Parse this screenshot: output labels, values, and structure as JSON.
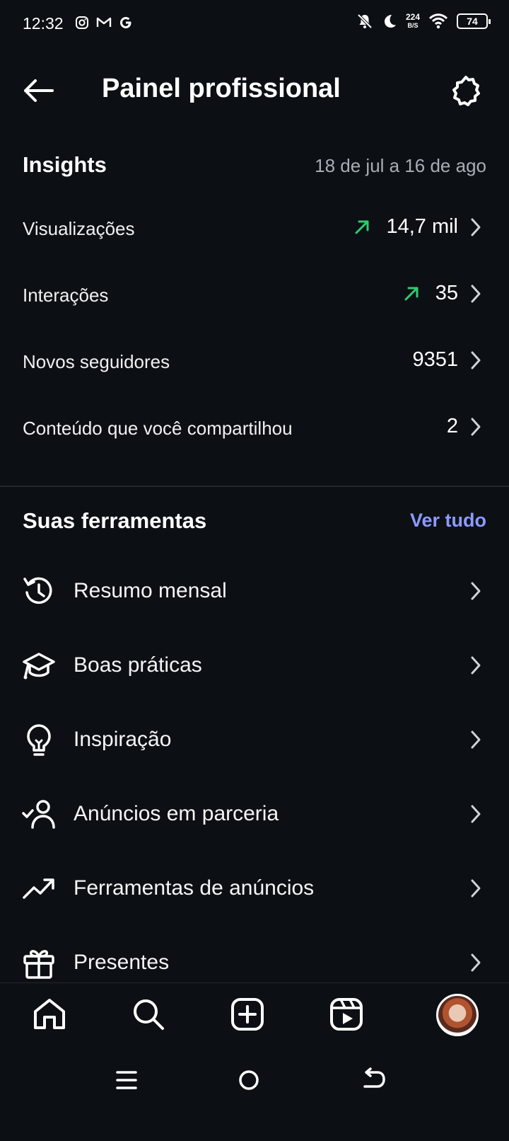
{
  "status_bar": {
    "time": "12:32",
    "net_speed_value": "224",
    "net_speed_unit": "B/S",
    "battery": "74",
    "app_icons": [
      "instagram-icon",
      "gmail-icon",
      "google-icon"
    ],
    "system_icons": [
      "bell-off-icon",
      "moon-icon",
      "wifi-icon",
      "battery-icon"
    ]
  },
  "header": {
    "title": "Painel profissional"
  },
  "insights": {
    "title": "Insights",
    "date_range": "18 de jul a 16 de ago",
    "metrics": [
      {
        "label": "Visualizações",
        "value": "14,7 mil",
        "trend": "up"
      },
      {
        "label": "Interações",
        "value": "35",
        "trend": "up"
      },
      {
        "label": "Novos seguidores",
        "value": "9351",
        "trend": "none"
      },
      {
        "label": "Conteúdo que você compartilhou",
        "value": "2",
        "trend": "none"
      }
    ]
  },
  "tools": {
    "title": "Suas ferramentas",
    "see_all": "Ver tudo",
    "items": [
      {
        "label": "Resumo mensal",
        "icon": "history-icon"
      },
      {
        "label": "Boas práticas",
        "icon": "graduation-cap-icon"
      },
      {
        "label": "Inspiração",
        "icon": "lightbulb-icon"
      },
      {
        "label": "Anúncios em parceria",
        "icon": "person-check-icon"
      },
      {
        "label": "Ferramentas de anúncios",
        "icon": "trending-up-icon"
      },
      {
        "label": "Presentes",
        "icon": "gift-icon"
      }
    ]
  },
  "bottom_nav": [
    "home-icon",
    "search-icon",
    "create-icon",
    "reels-icon",
    "profile-avatar"
  ],
  "colors": {
    "background": "#0c1014",
    "accent": "#8c9aff",
    "trend_up": "#2ecc71",
    "muted": "#a8adb5"
  }
}
